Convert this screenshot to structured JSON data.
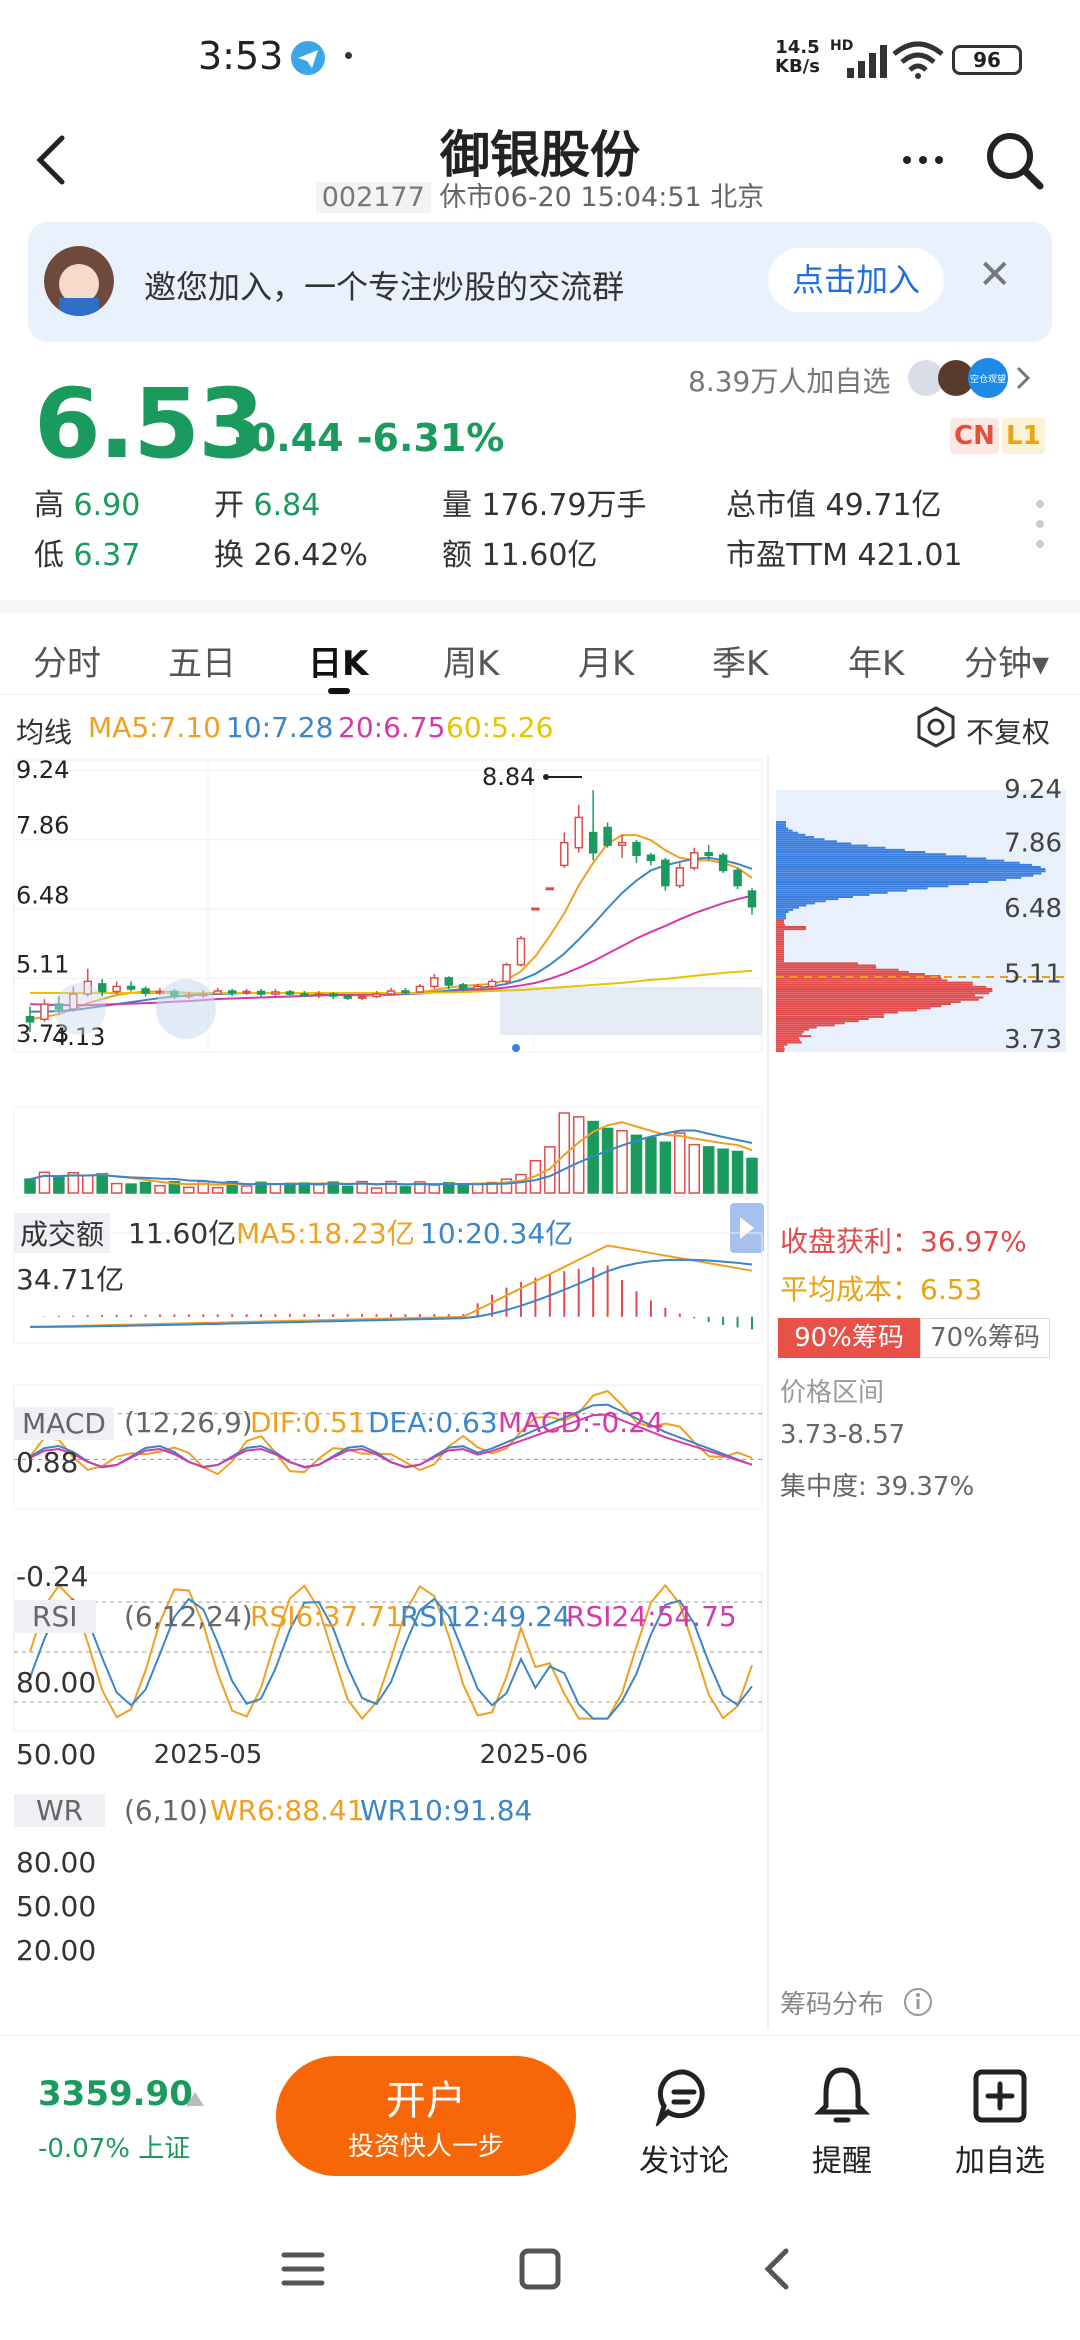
{
  "status": {
    "time": "3:53",
    "net_speed": "14.5",
    "net_unit": "KB/s",
    "hd": "HD",
    "battery": "96"
  },
  "header": {
    "title": "御银股份",
    "code": "002177",
    "subtitle": "休市06-20 15:04:51 北京"
  },
  "banner": {
    "text": "邀您加入，一个专注炒股的交流群",
    "join_label": "点击加入"
  },
  "quote": {
    "price": "6.53",
    "change": "-0.44 -6.31%",
    "watchers": "8.39万人加自选",
    "tags": [
      "CN",
      "L1"
    ],
    "high_label": "高",
    "high": "6.90",
    "low_label": "低",
    "low": "6.37",
    "open_label": "开",
    "open": "6.84",
    "turnover_label": "换",
    "turnover": "26.42%",
    "volume": "量 176.79万手",
    "amount": "额 11.60亿",
    "market_cap": "总市值 49.71亿",
    "pe": "市盈TTM 421.01",
    "avatar_label": "空仓观望"
  },
  "tabs": [
    "分时",
    "五日",
    "日K",
    "周K",
    "月K",
    "季K",
    "年K",
    "分钟▾"
  ],
  "active_tab": 2,
  "ma": {
    "label": "均线",
    "ma5": "MA5:7.10",
    "ma10": "10:7.28",
    "ma20": "20:6.75",
    "ma60": "60:5.26",
    "fuquan": "不复权"
  },
  "chart_data": {
    "type": "candlestick",
    "y_axis_ticks": [
      "9.24",
      "7.86",
      "6.48",
      "5.11",
      "3.73"
    ],
    "max_label": "8.84",
    "min_label": "4.13",
    "x_ticks": [
      "2025-05",
      "2025-06"
    ],
    "candles": [
      [
        4.35,
        4.25,
        4.55,
        4.05
      ],
      [
        4.3,
        4.6,
        4.7,
        4.25
      ],
      [
        4.6,
        4.5,
        4.75,
        4.4
      ],
      [
        4.5,
        4.8,
        4.95,
        4.45
      ],
      [
        4.8,
        5.05,
        5.3,
        4.75
      ],
      [
        5.0,
        4.85,
        5.1,
        4.75
      ],
      [
        4.85,
        4.95,
        5.05,
        4.8
      ],
      [
        4.95,
        4.9,
        5.05,
        4.85
      ],
      [
        4.9,
        4.82,
        4.95,
        4.75
      ],
      [
        4.82,
        4.85,
        4.92,
        4.78
      ],
      [
        4.85,
        4.75,
        4.9,
        4.7
      ],
      [
        4.75,
        4.78,
        4.85,
        4.7
      ],
      [
        4.78,
        4.8,
        4.88,
        4.72
      ],
      [
        4.8,
        4.86,
        4.92,
        4.78
      ],
      [
        4.86,
        4.82,
        4.9,
        4.76
      ],
      [
        4.82,
        4.85,
        4.9,
        4.78
      ],
      [
        4.85,
        4.8,
        4.9,
        4.75
      ],
      [
        4.8,
        4.84,
        4.9,
        4.76
      ],
      [
        4.84,
        4.8,
        4.88,
        4.76
      ],
      [
        4.8,
        4.78,
        4.86,
        4.74
      ],
      [
        4.78,
        4.8,
        4.86,
        4.72
      ],
      [
        4.8,
        4.76,
        4.84,
        4.7
      ],
      [
        4.76,
        4.72,
        4.8,
        4.68
      ],
      [
        4.72,
        4.75,
        4.8,
        4.68
      ],
      [
        4.75,
        4.8,
        4.86,
        4.72
      ],
      [
        4.8,
        4.86,
        4.92,
        4.76
      ],
      [
        4.86,
        4.84,
        4.92,
        4.8
      ],
      [
        4.84,
        4.95,
        5.0,
        4.82
      ],
      [
        4.95,
        5.12,
        5.2,
        4.9
      ],
      [
        5.12,
        4.98,
        5.15,
        4.9
      ],
      [
        4.98,
        4.9,
        5.02,
        4.85
      ],
      [
        4.9,
        4.95,
        5.0,
        4.86
      ],
      [
        4.95,
        5.05,
        5.1,
        4.9
      ],
      [
        5.05,
        5.38,
        5.42,
        5.0
      ],
      [
        5.38,
        5.9,
        5.95,
        5.35
      ],
      [
        6.5,
        6.5,
        6.5,
        6.5
      ],
      [
        6.9,
        6.9,
        6.9,
        6.9
      ],
      [
        7.35,
        7.8,
        8.0,
        7.3
      ],
      [
        7.7,
        8.3,
        8.55,
        7.6
      ],
      [
        8.0,
        7.6,
        8.84,
        7.45
      ],
      [
        8.1,
        7.75,
        8.2,
        7.7
      ],
      [
        7.75,
        7.8,
        7.95,
        7.5
      ],
      [
        7.8,
        7.55,
        7.85,
        7.4
      ],
      [
        7.55,
        7.45,
        7.6,
        7.35
      ],
      [
        7.45,
        6.95,
        7.5,
        6.85
      ],
      [
        6.95,
        7.3,
        7.4,
        6.9
      ],
      [
        7.3,
        7.6,
        7.7,
        7.25
      ],
      [
        7.6,
        7.55,
        7.75,
        7.45
      ],
      [
        7.55,
        7.25,
        7.6,
        7.2
      ],
      [
        7.25,
        6.95,
        7.3,
        6.88
      ],
      [
        6.84,
        6.53,
        6.9,
        6.37
      ]
    ],
    "ma5": [
      4.3,
      4.35,
      4.4,
      4.5,
      4.62,
      4.7,
      4.78,
      4.82,
      4.85,
      4.85,
      4.84,
      4.82,
      4.81,
      4.81,
      4.82,
      4.82,
      4.82,
      4.82,
      4.82,
      4.81,
      4.81,
      4.8,
      4.78,
      4.77,
      4.77,
      4.78,
      4.8,
      4.83,
      4.88,
      4.93,
      4.96,
      4.98,
      5.0,
      5.08,
      5.25,
      5.55,
      5.95,
      6.4,
      6.95,
      7.4,
      7.78,
      7.95,
      7.95,
      7.85,
      7.65,
      7.5,
      7.45,
      7.45,
      7.4,
      7.3,
      7.1
    ],
    "ma10": [
      4.45,
      4.45,
      4.46,
      4.48,
      4.52,
      4.56,
      4.6,
      4.64,
      4.68,
      4.72,
      4.75,
      4.77,
      4.79,
      4.8,
      4.81,
      4.82,
      4.82,
      4.82,
      4.82,
      4.82,
      4.81,
      4.81,
      4.8,
      4.79,
      4.79,
      4.79,
      4.8,
      4.81,
      4.84,
      4.87,
      4.9,
      4.92,
      4.95,
      5.0,
      5.08,
      5.2,
      5.38,
      5.6,
      5.88,
      6.18,
      6.5,
      6.8,
      7.05,
      7.25,
      7.35,
      7.42,
      7.48,
      7.5,
      7.45,
      7.38,
      7.28
    ],
    "ma20": [
      4.6,
      4.59,
      4.58,
      4.58,
      4.58,
      4.59,
      4.6,
      4.61,
      4.62,
      4.63,
      4.65,
      4.66,
      4.68,
      4.7,
      4.71,
      4.72,
      4.73,
      4.74,
      4.75,
      4.76,
      4.77,
      4.78,
      4.78,
      4.79,
      4.8,
      4.8,
      4.81,
      4.82,
      4.83,
      4.84,
      4.86,
      4.88,
      4.9,
      4.93,
      4.97,
      5.02,
      5.1,
      5.2,
      5.32,
      5.45,
      5.6,
      5.75,
      5.9,
      6.03,
      6.15,
      6.28,
      6.4,
      6.5,
      6.6,
      6.68,
      6.75
    ],
    "ma60": [
      4.82,
      4.82,
      4.82,
      4.82,
      4.82,
      4.82,
      4.82,
      4.82,
      4.82,
      4.82,
      4.82,
      4.82,
      4.82,
      4.82,
      4.82,
      4.82,
      4.82,
      4.82,
      4.82,
      4.82,
      4.82,
      4.82,
      4.82,
      4.82,
      4.82,
      4.82,
      4.82,
      4.82,
      4.83,
      4.83,
      4.84,
      4.85,
      4.86,
      4.87,
      4.88,
      4.9,
      4.92,
      4.94,
      4.96,
      4.98,
      5.0,
      5.02,
      5.05,
      5.08,
      5.1,
      5.13,
      5.16,
      5.19,
      5.22,
      5.24,
      5.26
    ]
  },
  "chips": {
    "ticks": [
      "9.24",
      "7.86",
      "6.48",
      "5.11",
      "3.73"
    ],
    "profit_label": "收盘获利：",
    "profit": "36.97%",
    "avg_cost_label": "平均成本：",
    "avg_cost": "6.53",
    "tab90": "90%筹码",
    "tab70": "70%筹码",
    "range_label": "价格区间",
    "range": "3.73-8.57",
    "concentration": "集中度: 39.37%",
    "footer": "筹码分布"
  },
  "volume": {
    "label": "成交额",
    "value": "11.60亿",
    "ma5": "MA5:18.23亿",
    "ma10": "10:20.34亿",
    "max": "34.71亿"
  },
  "macd": {
    "label": "MACD",
    "params": "(12,26,9)",
    "dif": "DIF:0.51",
    "dea": "DEA:0.63",
    "macd": "MACD:-0.24",
    "top": "0.88",
    "bottom": "-0.24"
  },
  "rsi": {
    "label": "RSI",
    "params": "(6,12,24)",
    "rsi6": "RSI6:37.71",
    "rsi12": "RSI12:49.24",
    "rsi24": "RSI24:54.75",
    "l80": "80.00",
    "l50": "50.00"
  },
  "wr": {
    "label": "WR",
    "params": "(6,10)",
    "wr6": "WR6:88.41",
    "wr10": "WR10:91.84",
    "l80": "80.00",
    "l50": "50.00",
    "l20": "20.00"
  },
  "bottombar": {
    "index": "3359.90",
    "index_change": "-0.07% 上证",
    "open_main": "开户",
    "open_sub": "投资快人一步",
    "discuss": "发讨论",
    "alert": "提醒",
    "add": "加自选"
  }
}
